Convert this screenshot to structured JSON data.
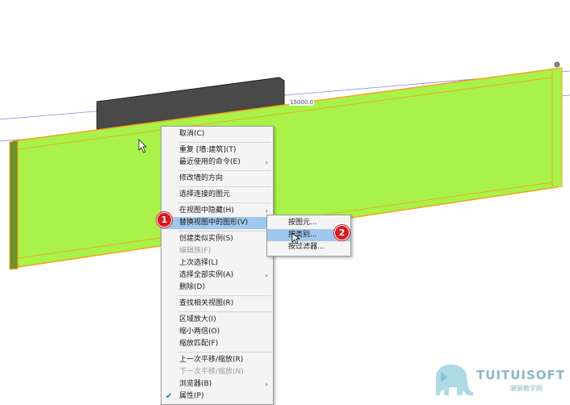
{
  "viewport": {
    "dimension_label": "15000.0"
  },
  "context_menu": {
    "items": [
      {
        "label": "取消(C)",
        "enabled": true
      },
      {
        "label": "重复 [墙:建筑](T)",
        "enabled": true
      },
      {
        "label": "最近使用的命令(E)",
        "enabled": true,
        "submenu": true
      },
      {
        "label": "修改墙的方向",
        "enabled": true
      },
      {
        "label": "选择连接的图元",
        "enabled": true
      },
      {
        "label": "在视图中隐藏(H)",
        "enabled": true,
        "submenu": true
      },
      {
        "label": "替换视图中的图形(V)",
        "enabled": true,
        "submenu": true,
        "highlighted": true
      },
      {
        "label": "创建类似实例(S)",
        "enabled": true
      },
      {
        "label": "编辑族(F)",
        "enabled": false
      },
      {
        "label": "上次选择(L)",
        "enabled": true
      },
      {
        "label": "选择全部实例(A)",
        "enabled": true,
        "submenu": true
      },
      {
        "label": "删除(D)",
        "enabled": true
      },
      {
        "label": "查找相关视图(R)",
        "enabled": true
      },
      {
        "label": "区域放大(I)",
        "enabled": true
      },
      {
        "label": "缩小两倍(O)",
        "enabled": true
      },
      {
        "label": "缩放匹配(F)",
        "enabled": true
      },
      {
        "label": "上一次平移/缩放(R)",
        "enabled": true
      },
      {
        "label": "下一次平移/缩放(N)",
        "enabled": false
      },
      {
        "label": "浏览器(B)",
        "enabled": true,
        "submenu": true
      },
      {
        "label": "属性(P)",
        "enabled": true,
        "checked": true
      }
    ]
  },
  "submenu": {
    "items": [
      {
        "label": "按图元...",
        "highlighted": false
      },
      {
        "label": "按类别...",
        "highlighted": true
      },
      {
        "label": "按过滤器...",
        "highlighted": false
      }
    ]
  },
  "annotations": {
    "badge1": "1",
    "badge2": "2"
  },
  "watermark": {
    "brand": "TUITUISOFT",
    "subtitle": "腿腿教学网"
  },
  "colors": {
    "wall_fill": "#a8f24a",
    "wall_outline": "#f5a21a",
    "back_wall": "#3a3a3a",
    "menu_highlight": "#9fc8ee",
    "badge": "#d81921"
  }
}
